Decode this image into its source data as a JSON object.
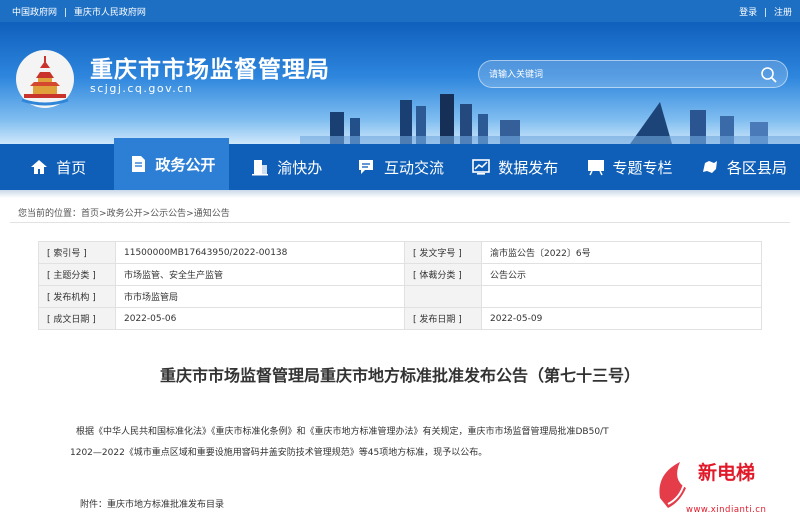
{
  "topbar": {
    "links": [
      "中国政府网",
      "重庆市人民政府网"
    ],
    "separator": "|",
    "login": "登录",
    "register": "注册"
  },
  "header": {
    "site_title": "重庆市市场监督管理局",
    "site_domain": "scjgj.cq.gov.cn",
    "search_placeholder": "请输入关键词",
    "logo": "chongqing-landmark-logo",
    "search_icon": "magnifier-icon"
  },
  "nav": {
    "items": [
      {
        "label": "首页",
        "icon": "home-icon",
        "active": false
      },
      {
        "label": "政务公开",
        "icon": "document-icon",
        "active": true
      },
      {
        "label": "渝快办",
        "icon": "building-icon",
        "active": false
      },
      {
        "label": "互动交流",
        "icon": "chat-icon",
        "active": false
      },
      {
        "label": "数据发布",
        "icon": "chart-icon",
        "active": false
      },
      {
        "label": "专题专栏",
        "icon": "board-icon",
        "active": false
      },
      {
        "label": "各区县局",
        "icon": "map-icon",
        "active": false
      }
    ]
  },
  "breadcrumb": {
    "prefix": "您当前的位置：",
    "items": [
      "首页",
      "政务公开",
      "公示公告",
      "通知公告"
    ],
    "separator": ">"
  },
  "info_table": {
    "rows": [
      {
        "k1": "[ 索引号 ]",
        "v1": "11500000MB17643950/2022-00138",
        "k2": "[ 发文字号 ]",
        "v2": "渝市监公告〔2022〕6号"
      },
      {
        "k1": "[ 主题分类 ]",
        "v1": "市场监管、安全生产监管",
        "k2": "[ 体裁分类 ]",
        "v2": "公告公示"
      },
      {
        "k1": "[ 发布机构 ]",
        "v1": "市市场监管局",
        "k2": "",
        "v2": ""
      },
      {
        "k1": "[ 成文日期 ]",
        "v1": "2022-05-06",
        "k2": "[ 发布日期 ]",
        "v2": "2022-05-09"
      }
    ]
  },
  "document": {
    "title": "重庆市市场监督管理局重庆市地方标准批准发布公告（第七十三号）",
    "paragraph_line1": "根据《中华人民共和国标准化法》《重庆市标准化条例》和《重庆市地方标准管理办法》有关规定，重庆市市场监督管理局批准DB50/T",
    "paragraph_line2": "1202—2022《城市重点区域和重要设施用窨码井盖安防技术管理规范》等45项地方标准，现予以公布。",
    "attachment": "附件：重庆市地方标准批准发布目录"
  },
  "watermark": {
    "text": "新电梯",
    "url": "www.xindianti.cn"
  },
  "colors": {
    "topbar": "#1d6fc4",
    "nav": "#0f5fb8",
    "nav_active": "#2d7fd6",
    "watermark": "#e11a2a"
  }
}
